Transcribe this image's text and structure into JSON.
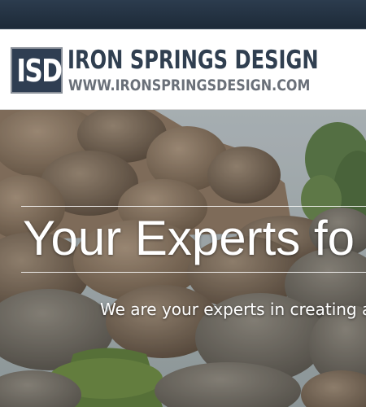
{
  "header": {
    "logo_mark": "ISD",
    "logo_title": "IRON SPRINGS DESIGN",
    "logo_url": "WWW.IRONSPRINGSDESIGN.COM"
  },
  "hero": {
    "title": "Your Experts fo",
    "subtitle": "We are your experts in creating a"
  },
  "colors": {
    "topbar": "#23313f",
    "logo_navy": "#303f50",
    "logo_gray": "#6a7079",
    "hero_text": "#ffffff"
  }
}
